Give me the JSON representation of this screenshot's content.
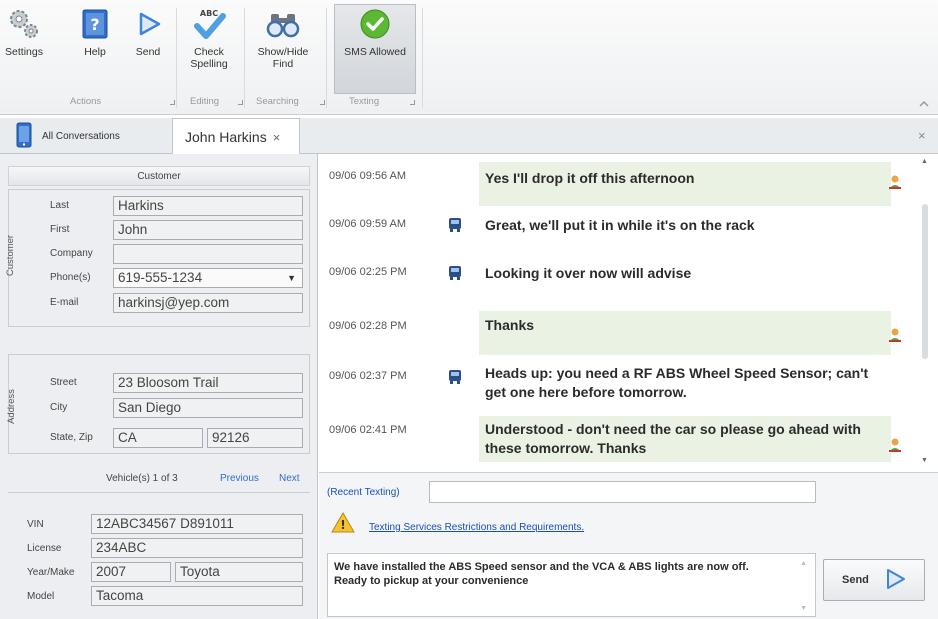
{
  "ribbon": {
    "buttons": {
      "settings": "Settings",
      "help": "Help",
      "send": "Send",
      "check_spelling": "Check Spelling",
      "show_hide_find": "Show/Hide Find",
      "sms_allowed": "SMS Allowed"
    },
    "groups": {
      "actions": "Actions",
      "editing": "Editing",
      "searching": "Searching",
      "texting": "Texting"
    },
    "spell_badge": "ABC"
  },
  "tabs": {
    "all_conversations": "All Conversations",
    "john_harkins": "John Harkins",
    "close_glyph": "×"
  },
  "customer": {
    "header": "Customer",
    "side_label": "Customer",
    "labels": {
      "last": "Last",
      "first": "First",
      "company": "Company",
      "phones": "Phone(s)",
      "email": "E-mail"
    },
    "values": {
      "last": "Harkins",
      "first": "John",
      "company": "",
      "phone": "619-555-1234",
      "email": "harkinsj@yep.com"
    }
  },
  "address": {
    "side_label": "Address",
    "labels": {
      "street": "Street",
      "city": "City",
      "state_zip": "State, Zip"
    },
    "values": {
      "street": "23 Bloosom Trail",
      "city": "San Diego",
      "state": "CA",
      "zip": "92126"
    }
  },
  "vehicle": {
    "header": "Vehicle(s) 1 of 3",
    "previous": "Previous",
    "next": "Next",
    "labels": {
      "vin": "VIN",
      "license": "License",
      "year_make": "Year/Make",
      "model": "Model"
    },
    "values": {
      "vin": "12ABC34567 D891011",
      "license": "234ABC",
      "year": "2007",
      "make": "Toyota",
      "model": "Tacoma"
    }
  },
  "messages": [
    {
      "time": "09/06 09:56 AM",
      "text": "Yes I'll drop it off this afternoon",
      "from": "customer"
    },
    {
      "time": "09/06 09:59 AM",
      "text": "Great, we'll put it in while it's on the rack",
      "from": "shop"
    },
    {
      "time": "09/06 02:25 PM",
      "text": "Looking it over now will advise",
      "from": "shop"
    },
    {
      "time": "09/06 02:28 PM",
      "text": "Thanks",
      "from": "customer"
    },
    {
      "time": "09/06 02:37 PM",
      "text": "Heads up: you need a RF ABS Wheel Speed Sensor; can't get one here before tomorrow.",
      "from": "shop"
    },
    {
      "time": "09/06 02:41 PM",
      "text": "Understood - don't need the car so please go ahead with these tomorrow. Thanks",
      "from": "customer"
    }
  ],
  "compose": {
    "recent_label": "(Recent Texting)",
    "recent_value": "",
    "warning_link": "Texting Services Restrictions and Requirements.",
    "draft": "We have installed the ABS Speed sensor and the VCA & ABS lights are now off. Ready to pickup at your convenience",
    "send_label": "Send"
  },
  "colors": {
    "customer_bubble": "#eaf2e4",
    "link": "#1a4fb5",
    "accent_blue": "#2f6fc9",
    "sms_green": "#5cb832"
  }
}
